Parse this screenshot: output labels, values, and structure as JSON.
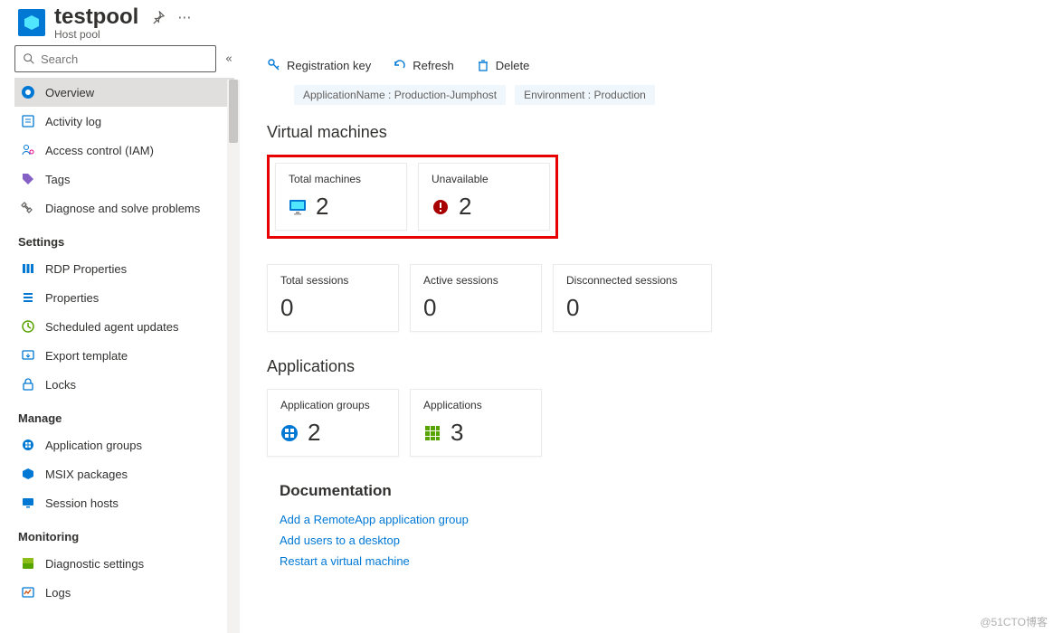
{
  "header": {
    "title": "testpool",
    "subtitle": "Host pool"
  },
  "search": {
    "placeholder": "Search"
  },
  "sidebar": {
    "items": [
      {
        "label": "Overview",
        "icon": "overview",
        "active": true
      },
      {
        "label": "Activity log",
        "icon": "activity"
      },
      {
        "label": "Access control (IAM)",
        "icon": "access"
      },
      {
        "label": "Tags",
        "icon": "tags"
      },
      {
        "label": "Diagnose and solve problems",
        "icon": "diagnose"
      }
    ],
    "groups": [
      {
        "title": "Settings",
        "items": [
          {
            "label": "RDP Properties",
            "icon": "rdp"
          },
          {
            "label": "Properties",
            "icon": "props"
          },
          {
            "label": "Scheduled agent updates",
            "icon": "schedule"
          },
          {
            "label": "Export template",
            "icon": "export"
          },
          {
            "label": "Locks",
            "icon": "lock"
          }
        ]
      },
      {
        "title": "Manage",
        "items": [
          {
            "label": "Application groups",
            "icon": "appgroups"
          },
          {
            "label": "MSIX packages",
            "icon": "msix"
          },
          {
            "label": "Session hosts",
            "icon": "session"
          }
        ]
      },
      {
        "title": "Monitoring",
        "items": [
          {
            "label": "Diagnostic settings",
            "icon": "diag"
          },
          {
            "label": "Logs",
            "icon": "logs"
          }
        ]
      }
    ]
  },
  "toolbar": {
    "registration": "Registration key",
    "refresh": "Refresh",
    "delete": "Delete"
  },
  "tags": [
    "ApplicationName : Production-Jumphost",
    "Environment : Production"
  ],
  "sections": {
    "vm_title": "Virtual machines",
    "vm_cards": [
      {
        "label": "Total machines",
        "value": "2",
        "icon": "monitor"
      },
      {
        "label": "Unavailable",
        "value": "2",
        "icon": "error"
      }
    ],
    "session_cards": [
      {
        "label": "Total sessions",
        "value": "0"
      },
      {
        "label": "Active sessions",
        "value": "0"
      },
      {
        "label": "Disconnected sessions",
        "value": "0"
      }
    ],
    "apps_title": "Applications",
    "apps_cards": [
      {
        "label": "Application groups",
        "value": "2",
        "icon": "grid-blue"
      },
      {
        "label": "Applications",
        "value": "3",
        "icon": "grid-green"
      }
    ],
    "doc_title": "Documentation",
    "doc_links": [
      "Add a RemoteApp application group",
      "Add users to a desktop",
      "Restart a virtual machine"
    ]
  },
  "watermark": "@51CTO博客"
}
